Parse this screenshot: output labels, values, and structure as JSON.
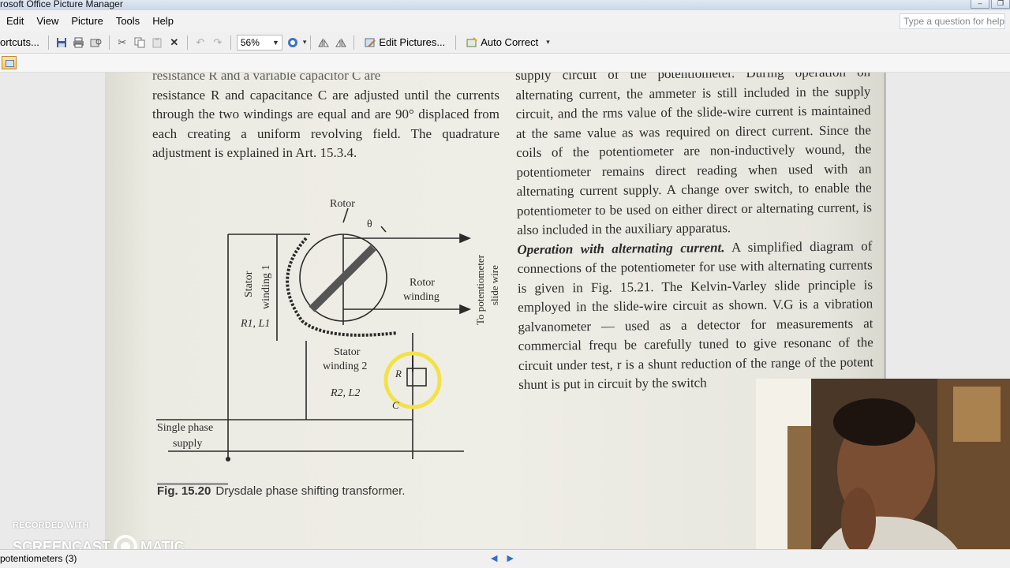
{
  "window": {
    "title": "rosoft Office Picture Manager",
    "controls": [
      "minimize",
      "restore",
      "close"
    ]
  },
  "menu": {
    "items": [
      "Edit",
      "View",
      "Picture",
      "Tools",
      "Help"
    ],
    "help_placeholder": "Type a question for help"
  },
  "toolbar": {
    "shortcuts_label": "ortcuts...",
    "zoom_value": "56%",
    "edit_pictures_label": "Edit Pictures...",
    "auto_correct_label": "Auto Correct"
  },
  "document": {
    "left_column": [
      "resistance  R  and  a  variable  capacitor  C  are",
      "resistance  R and capacitance C are adjusted until the currents through the two windings are equal and are 90° displaced from each creating a uniform revolving field. The quadrature adjustment is explained in Art. 15.3.4."
    ],
    "right_column_para1": "supply circuit of the potentiometer. During operation on alternating current, the ammeter is still included in the supply circuit, and the rms value of the slide-wire current is maintained at the same value as was required on direct current. Since the coils of the potentiometer are non-inductively wound, the potentiometer remains direct reading when used with an alternating current supply. A change over switch, to enable the potentiometer to be used on either direct or alternating current, is also included in the auxiliary apparatus.",
    "right_heading": "Operation with alternating current.",
    "right_column_para2": " A simplified diagram of connections of the potentiometer for use with alternating currents is given in Fig. 15.21. The Kelvin-Varley slide principle is employed in the slide-wire circuit as shown. V.G is a vibration galvanometer — used as a detector for measurements at commercial frequ be carefully tuned to give resonanc of the circuit under test, r is a shunt reduction of the range of the potent shunt is put in circuit by the switch",
    "figure_number": "Fig. 15.20",
    "figure_title": "Drysdale phase shifting transformer.",
    "diagram_labels": {
      "rotor": "Rotor",
      "theta": "θ",
      "stator1a": "Stator",
      "stator1b": "winding 1",
      "r1l1": "R1, L1",
      "rotor_winding_a": "Rotor",
      "rotor_winding_b": "winding",
      "to_pot_a": "To potentiometer",
      "to_pot_b": "slide wire",
      "stator2a": "Stator",
      "stator2b": "winding 2",
      "r2l2": "R2, L2",
      "r": "R",
      "c": "C",
      "supply_a": "Single phase",
      "supply_b": "supply"
    }
  },
  "watermark": {
    "recorded_with": "RECORDED WITH",
    "brand_left": "SCREENCAST",
    "brand_right": "MATIC"
  },
  "status": {
    "label": "potentiometers (3)"
  },
  "colors": {
    "accent": "#2f6fc7",
    "highlight_ring": "#f2e24a"
  }
}
